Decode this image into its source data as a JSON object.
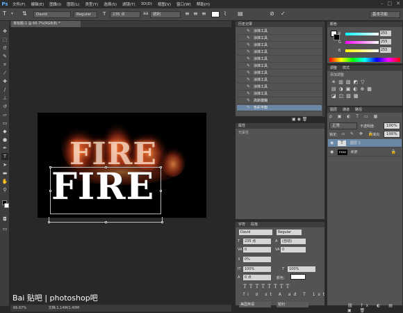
{
  "menubar": {
    "logo": "Ps",
    "items": [
      "文件(F)",
      "编辑(E)",
      "图像(I)",
      "图层(L)",
      "类型(Y)",
      "选择(S)",
      "滤镜(T)",
      "3D(D)",
      "视图(V)",
      "窗口(W)",
      "帮助(H)"
    ]
  },
  "options": {
    "font_family": "David",
    "font_style": "Regular",
    "font_size": "235 点",
    "antialias": "锐利"
  },
  "document": {
    "tab": "未标题-1 @ 66.7%(RGB/8) *",
    "text_main": "FIRE",
    "text_flame": "FIRE"
  },
  "status": {
    "zoom": "66.67%",
    "doc": "文档:1.14M/1.40M"
  },
  "history": {
    "title": "历史记录",
    "items": [
      "涂抹工具",
      "涂抹工具",
      "涂抹工具",
      "涂抹工具",
      "涂抹工具",
      "涂抹工具",
      "涂抹工具",
      "涂抹工具",
      "涂抹工具",
      "涂抹工具",
      "高斯模糊",
      "色彩平衡"
    ]
  },
  "properties": {
    "title": "属性",
    "empty": "无属性"
  },
  "color": {
    "tab": "颜色",
    "r": "255",
    "g": "255",
    "b": "255",
    "r_label": "R",
    "g_label": "G",
    "b_label": "B"
  },
  "adjust": {
    "tabs": [
      "调整",
      "样式"
    ],
    "add": "添加调整"
  },
  "layers": {
    "tabs": [
      "图层",
      "通道",
      "路径"
    ],
    "mode": "正常",
    "opacity_label": "不透明度:",
    "opacity": "100%",
    "lock_label": "锁定:",
    "fill_label": "填充:",
    "fill": "100%",
    "rows": [
      {
        "name": "图层 1",
        "thumb": "T"
      },
      {
        "name": "背景",
        "thumb": "FIRE"
      }
    ]
  },
  "character": {
    "tabs": [
      "字符",
      "段落"
    ],
    "font": "David",
    "style": "Regular",
    "size": "235 点",
    "leading": "(自动)",
    "kerning": "0",
    "tracking": "0",
    "vscale": "0%",
    "hscale1": "100%",
    "hscale2": "100%",
    "baseline": "0 点",
    "color_label": "颜色:",
    "lang": "美国英语",
    "aa": "锐利"
  },
  "workspace": "基本功能",
  "watermark": "Bai 贴吧 | photoshop吧"
}
